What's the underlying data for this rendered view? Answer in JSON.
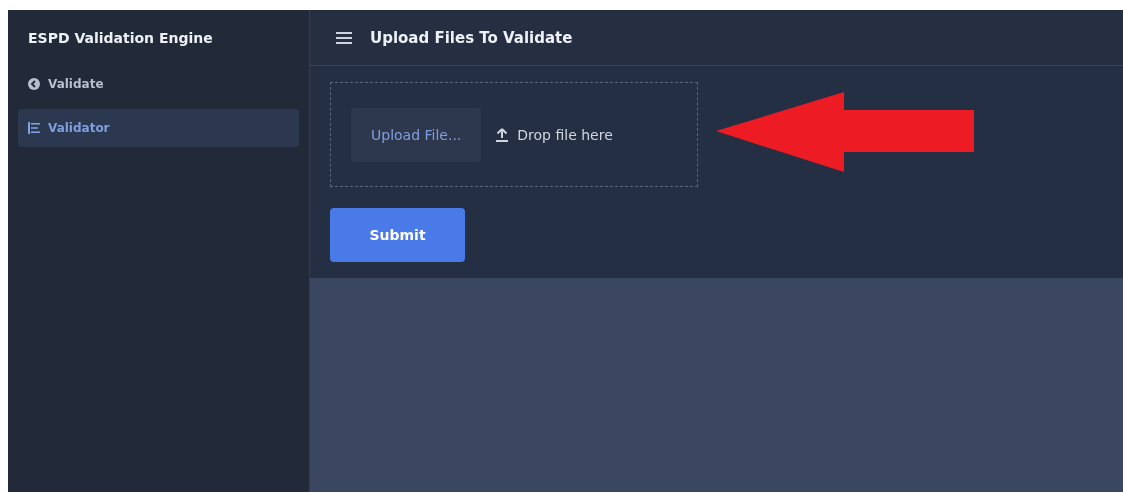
{
  "sidebar": {
    "title": "ESPD Validation Engine",
    "items": [
      {
        "label": "Validate",
        "selected": false
      },
      {
        "label": "Validator",
        "selected": true
      }
    ]
  },
  "header": {
    "title": "Upload Files To Validate"
  },
  "upload": {
    "button": "Upload File...",
    "drop_hint": "Drop file here"
  },
  "submit": "Submit"
}
